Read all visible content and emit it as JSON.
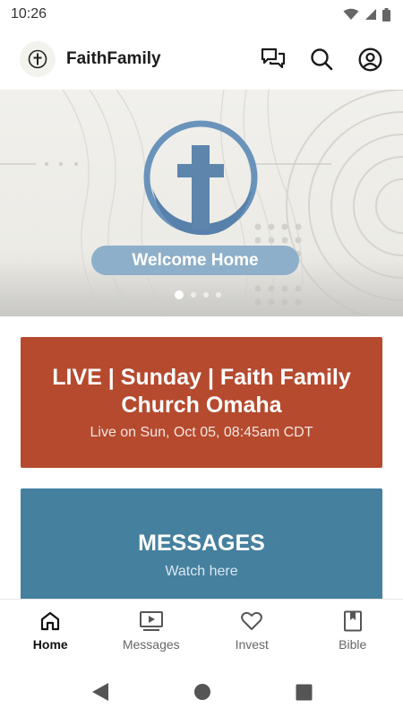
{
  "status_bar": {
    "time": "10:26"
  },
  "app": {
    "title": "FaithFamily"
  },
  "hero": {
    "welcome_label": "Welcome Home",
    "slides_total": 4,
    "active_slide": 1
  },
  "cards": {
    "live": {
      "title": "LIVE | Sunday | Faith Family Church Omaha",
      "subtitle": "Live on Sun, Oct 05, 08:45am CDT",
      "color": "#b54a2f"
    },
    "messages": {
      "title": "MESSAGES",
      "subtitle": "Watch here",
      "color": "#45809f"
    }
  },
  "bottom_nav": {
    "items": [
      {
        "label": "Home",
        "icon": "home-icon",
        "active": true
      },
      {
        "label": "Messages",
        "icon": "play-screen-icon",
        "active": false
      },
      {
        "label": "Invest",
        "icon": "heart-icon",
        "active": false
      },
      {
        "label": "Bible",
        "icon": "bookmark-book-icon",
        "active": false
      }
    ]
  },
  "colors": {
    "pill": "#8eafc9",
    "cross_blue": "#5e8ab4"
  }
}
